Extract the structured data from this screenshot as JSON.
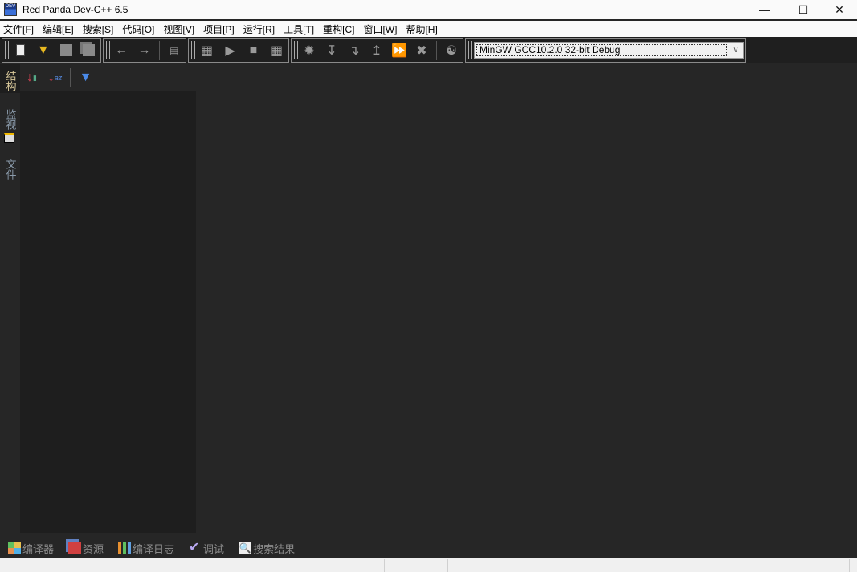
{
  "window": {
    "title": "Red Panda Dev-C++ 6.5",
    "icon": "DEV"
  },
  "menu": [
    "文件[F]",
    "编辑[E]",
    "搜索[S]",
    "代码[O]",
    "视图[V]",
    "项目[P]",
    "运行[R]",
    "工具[T]",
    "重构[C]",
    "窗口[W]",
    "帮助[H]"
  ],
  "toolbar": {
    "compiler_set": "MinGW GCC10.2.0 32-bit Debug"
  },
  "side_tabs": [
    "结构",
    "监视",
    "文件"
  ],
  "bottom_tabs": [
    "编译器",
    "资源",
    "编译日志",
    "调试",
    "搜索结果"
  ],
  "colors": {
    "background": "#262626",
    "panel": "#1e1e1e",
    "toolbar": "#1f1f1f"
  }
}
